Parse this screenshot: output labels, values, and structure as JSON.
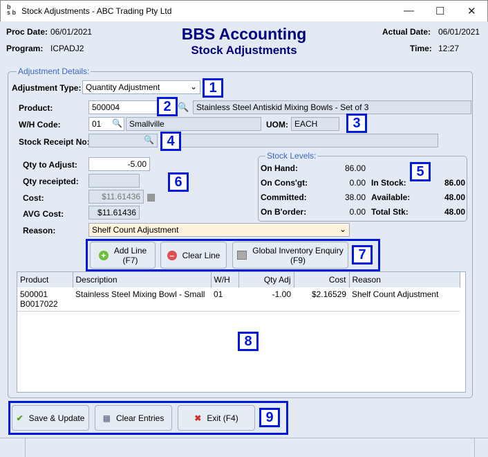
{
  "window": {
    "title": "Stock Adjustments - ABC Trading Pty Ltd",
    "logo": "bbs"
  },
  "header": {
    "proc_date_label": "Proc Date:",
    "proc_date": "06/01/2021",
    "program_label": "Program:",
    "program": "ICPADJ2",
    "app_title": "BBS Accounting",
    "screen_title": "Stock Adjustments",
    "actual_date_label": "Actual Date:",
    "actual_date": "06/01/2021",
    "time_label": "Time:",
    "time": "12:27"
  },
  "details": {
    "group_title": "Adjustment Details:",
    "adj_type_label": "Adjustment Type:",
    "adj_type": "Quantity Adjustment",
    "product_label": "Product:",
    "product": "500004",
    "product_desc": "Stainless Steel Antiskid Mixing Bowls - Set of 3",
    "wh_label": "W/H Code:",
    "wh": "01",
    "wh_name": "Smallville",
    "uom_label": "UOM:",
    "uom": "EACH",
    "receipt_label": "Stock Receipt No:",
    "receipt": "",
    "qty_adjust_label": "Qty to Adjust:",
    "qty_adjust": "-5.00",
    "qty_receipted_label": "Qty receipted:",
    "qty_receipted": "",
    "cost_label": "Cost:",
    "cost": "$11.61436",
    "avg_cost_label": "AVG Cost:",
    "avg_cost": "$11.61436",
    "reason_label": "Reason:",
    "reason": "Shelf Count Adjustment"
  },
  "stock_levels": {
    "title": "Stock Levels:",
    "on_hand_label": "On Hand:",
    "on_hand": "86.00",
    "on_consgt_label": "On Cons'gt:",
    "on_consgt": "0.00",
    "committed_label": "Committed:",
    "committed": "38.00",
    "on_border_label": "On B'order:",
    "on_border": "0.00",
    "in_stock_label": "In Stock:",
    "in_stock": "86.00",
    "available_label": "Available:",
    "available": "48.00",
    "total_label": "Total Stk:",
    "total": "48.00"
  },
  "line_buttons": {
    "add": "Add Line",
    "add_key": "(F7)",
    "clear": "Clear Line",
    "global": "Global Inventory Enquiry",
    "global_key": "(F9)"
  },
  "grid": {
    "columns": [
      "Product",
      "Description",
      "W/H",
      "Qty Adj",
      "Cost",
      "Reason"
    ],
    "rows": [
      {
        "product": "500001",
        "product2": "B0017022",
        "description": "Stainless Steel Mixing Bowl - Small",
        "wh": "01",
        "qty": "-1.00",
        "cost": "$2.16529",
        "reason": "Shelf Count Adjustment"
      }
    ]
  },
  "footer": {
    "save": "Save & Update",
    "clear": "Clear Entries",
    "exit": "Exit (F4)"
  },
  "callouts": [
    "1",
    "2",
    "3",
    "4",
    "5",
    "6",
    "7",
    "8",
    "9"
  ],
  "colors": {
    "callout": "#0018e0",
    "header_text": "#000080",
    "background": "#e3eaf3"
  }
}
